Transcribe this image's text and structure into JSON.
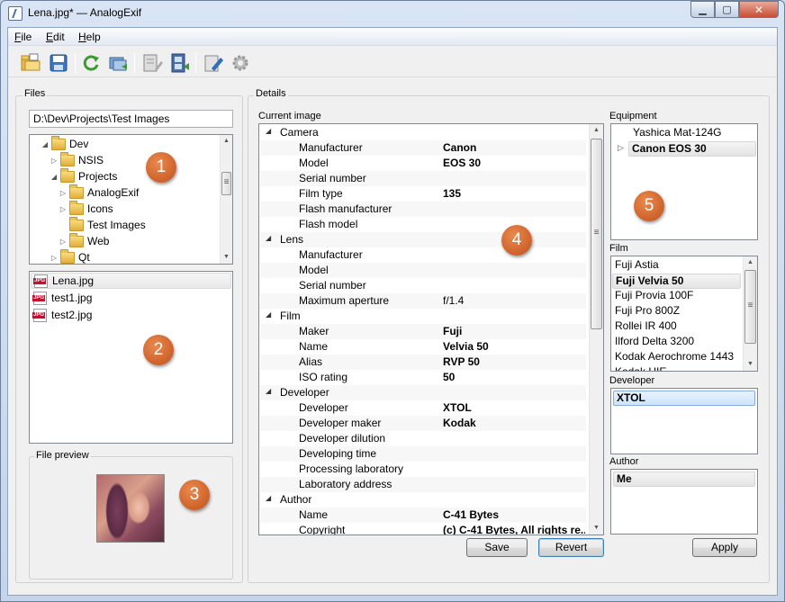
{
  "window": {
    "title": "Lena.jpg* — AnalogExif",
    "min": "▁",
    "max": "▢",
    "close": "✕"
  },
  "menu": [
    {
      "label": "F",
      "rest": "ile"
    },
    {
      "label": "E",
      "rest": "dit"
    },
    {
      "label": "H",
      "rest": "elp"
    }
  ],
  "toolbar_icons": [
    "open-folder-icon",
    "save-icon",
    "reload-icon",
    "batch-open-icon",
    "edit-metadata-icon",
    "film-metadata-icon",
    "copy-metadata-icon",
    "settings-gear-icon"
  ],
  "files": {
    "group_label": "Files",
    "path": "D:\\Dev\\Projects\\Test Images",
    "tree": [
      {
        "label": "Dev",
        "arrow": "◢"
      },
      {
        "label": "NSIS",
        "arrow": "▷"
      },
      {
        "label": "Projects",
        "arrow": "◢"
      },
      {
        "label": "AnalogExif",
        "arrow": "▷"
      },
      {
        "label": "Icons",
        "arrow": "▷"
      },
      {
        "label": "Test Images",
        "arrow": ""
      },
      {
        "label": "Web",
        "arrow": "▷"
      },
      {
        "label": "Qt",
        "arrow": "▷"
      }
    ],
    "list": [
      "Lena.jpg",
      "test1.jpg",
      "test2.jpg"
    ],
    "preview_label": "File preview"
  },
  "details": {
    "group_label": "Details",
    "current_image_label": "Current image",
    "rows": [
      {
        "kind": "cat",
        "label": "Camera"
      },
      {
        "kind": "prop",
        "label": "Manufacturer",
        "value": "Canon"
      },
      {
        "kind": "prop",
        "label": "Model",
        "value": "EOS 30"
      },
      {
        "kind": "prop",
        "label": "Serial number",
        "value": ""
      },
      {
        "kind": "prop",
        "label": "Film type",
        "value": "135"
      },
      {
        "kind": "prop",
        "label": "Flash manufacturer",
        "value": ""
      },
      {
        "kind": "prop",
        "label": "Flash model",
        "value": ""
      },
      {
        "kind": "cat",
        "label": "Lens"
      },
      {
        "kind": "prop",
        "label": "Manufacturer",
        "value": ""
      },
      {
        "kind": "prop",
        "label": "Model",
        "value": ""
      },
      {
        "kind": "prop",
        "label": "Serial number",
        "value": ""
      },
      {
        "kind": "prop",
        "label": "Maximum aperture",
        "value": "f/1.4",
        "normal": true
      },
      {
        "kind": "cat",
        "label": "Film"
      },
      {
        "kind": "prop",
        "label": "Maker",
        "value": "Fuji"
      },
      {
        "kind": "prop",
        "label": "Name",
        "value": "Velvia 50"
      },
      {
        "kind": "prop",
        "label": "Alias",
        "value": "RVP 50"
      },
      {
        "kind": "prop",
        "label": "ISO rating",
        "value": "50"
      },
      {
        "kind": "cat",
        "label": "Developer"
      },
      {
        "kind": "prop",
        "label": "Developer",
        "value": "XTOL"
      },
      {
        "kind": "prop",
        "label": "Developer maker",
        "value": "Kodak"
      },
      {
        "kind": "prop",
        "label": "Developer dilution",
        "value": ""
      },
      {
        "kind": "prop",
        "label": "Developing time",
        "value": ""
      },
      {
        "kind": "prop",
        "label": "Processing laboratory",
        "value": ""
      },
      {
        "kind": "prop",
        "label": "Laboratory address",
        "value": ""
      },
      {
        "kind": "cat",
        "label": "Author"
      },
      {
        "kind": "prop",
        "label": "Name",
        "value": "C-41 Bytes"
      },
      {
        "kind": "prop",
        "label": "Copyright",
        "value": "(c) C-41 Bytes, All rights re..."
      }
    ],
    "save": "Save",
    "revert": "Revert"
  },
  "equipment": {
    "label": "Equipment",
    "items": [
      "Yashica Mat-124G",
      "Canon EOS 30"
    ],
    "expand_arrow": "▷"
  },
  "film": {
    "label": "Film",
    "items": [
      "Fuji Astia",
      "Fuji Velvia 50",
      "Fuji Provia 100F",
      "Fuji Pro 800Z",
      "Rollei IR 400",
      "Ilford Delta 3200",
      "Kodak Aerochrome 1443",
      "Kodak HIE"
    ]
  },
  "developer": {
    "label": "Developer",
    "items": [
      "XTOL"
    ]
  },
  "author": {
    "label": "Author",
    "items": [
      "Me"
    ]
  },
  "apply": "Apply",
  "badges": [
    "1",
    "2",
    "3",
    "4",
    "5"
  ]
}
